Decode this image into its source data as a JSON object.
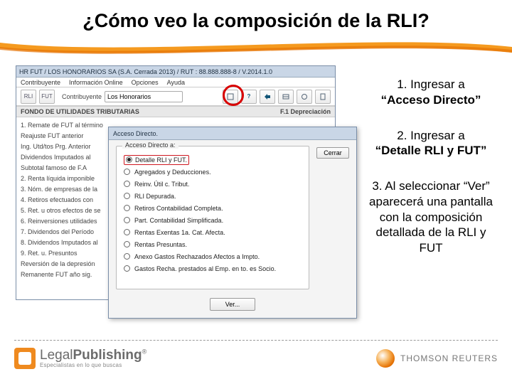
{
  "title": "¿Cómo veo la composición de la RLI?",
  "app": {
    "titlebar": "HR FUT / LOS HONORARIOS SA  (S.A. Cerrada 2013) / RUT : 88.888.888-8 / V.2014.1.0",
    "menu": [
      "Contribuyente",
      "Información Online",
      "Opciones",
      "Ayuda"
    ],
    "toolbar": {
      "btn1": "RLI",
      "btn2": "FUT",
      "contrib_label": "Contribuyente",
      "contrib_value": "Los Honorarios"
    },
    "section_title": "FONDO DE UTILIDADES TRIBUTARIAS",
    "section_right": "F.1 Depreciación",
    "rows": [
      "1.   Remate de FUT al término",
      "     Reajuste FUT anterior",
      "     Ing. Utd/tos Prg. Anterior",
      "     Dividendos Imputados al",
      "     Subtotal famoso de F.A",
      "2.   Renta líquida imponible",
      "3.   Nóm. de empresas de la",
      "4.   Retiros efectuados con",
      "5.   Ret. u otros efectos de se",
      "6.   Reinversiones utilidades",
      "7.   Dividendos del Período",
      "8.   Dividendos Imputados al",
      "9.   Ret. u. Presuntos",
      "     Reversión de la depresión",
      "     Remanente FUT año sig."
    ]
  },
  "dialog": {
    "title": "Acceso Directo.",
    "group_label": "Acceso Directo a:",
    "options": [
      "Detalle RLI y FUT.",
      "Agregados y Deducciones.",
      "Reinv. Útil c. Tribut.",
      "RLI Depurada.",
      "Retiros Contabilidad Completa.",
      "Part. Contabilidad Simplificada.",
      "Rentas Exentas 1a. Cat. Afecta.",
      "Rentas Presuntas.",
      "Anexo Gastos Rechazados Afectos a Impto.",
      "Gastos Recha. prestados al Emp. en to. es Socio."
    ],
    "selected_index": 0,
    "ver": "Ver...",
    "cerrar": "Cerrar"
  },
  "steps": {
    "s1a": "1.    Ingresar a",
    "s1b": "“Acceso Directo”",
    "s2a": "2. Ingresar a",
    "s2b": "“Detalle RLI y FUT”",
    "s3": "3. Al seleccionar “Ver” aparecerá una pantalla con la composición detallada de la RLI y FUT"
  },
  "footer": {
    "lp_main": "LegalPublishing",
    "lp_reg": "®",
    "lp_sub": "Especialistas en lo que buscas",
    "tr": "THOMSON REUTERS"
  }
}
